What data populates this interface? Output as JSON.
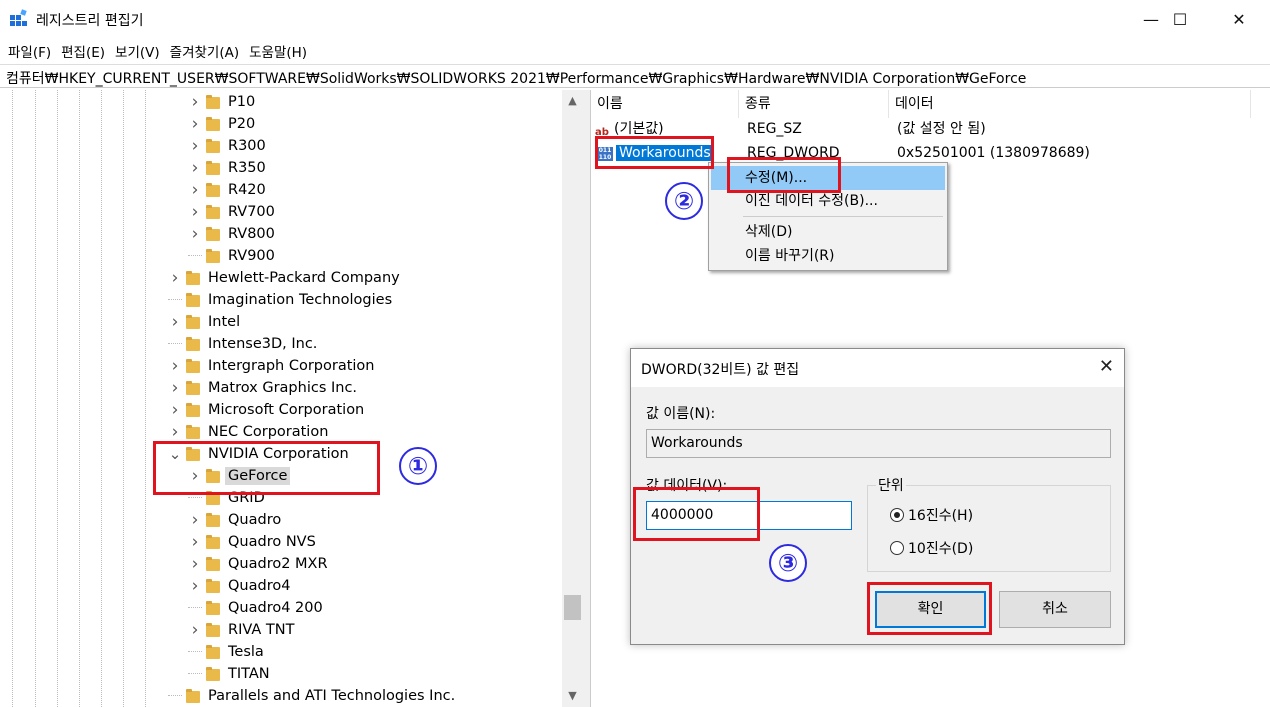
{
  "window": {
    "title": "레지스트리 편집기",
    "minimize_glyph": "—",
    "maximize_glyph": "☐",
    "close_glyph": "✕"
  },
  "menu": [
    "파일(F)",
    "편집(E)",
    "보기(V)",
    "즐겨찾기(A)",
    "도움말(H)"
  ],
  "address": "컴퓨터₩HKEY_CURRENT_USER₩SOFTWARE₩SolidWorks₩SOLIDWORKS 2021₩Performance₩Graphics₩Hardware₩NVIDIA Corporation₩GeForce",
  "tree": {
    "items": [
      {
        "label": "P10",
        "expandable": true
      },
      {
        "label": "P20",
        "expandable": true
      },
      {
        "label": "R300",
        "expandable": true
      },
      {
        "label": "R350",
        "expandable": true
      },
      {
        "label": "R420",
        "expandable": true
      },
      {
        "label": "RV700",
        "expandable": true
      },
      {
        "label": "RV800",
        "expandable": true
      },
      {
        "label": "RV900",
        "expandable": false
      },
      {
        "label": "Hewlett-Packard Company",
        "expandable": true
      },
      {
        "label": "Imagination Technologies",
        "expandable": false
      },
      {
        "label": "Intel",
        "expandable": true
      },
      {
        "label": "Intense3D, Inc.",
        "expandable": false
      },
      {
        "label": "Intergraph Corporation",
        "expandable": true
      },
      {
        "label": "Matrox Graphics Inc.",
        "expandable": true
      },
      {
        "label": "Microsoft Corporation",
        "expandable": true
      },
      {
        "label": "NEC Corporation",
        "expandable": true
      },
      {
        "label": "NVIDIA Corporation",
        "expandable": true,
        "expanded": true
      },
      {
        "label": "GeForce",
        "expandable": true,
        "selected": true
      },
      {
        "label": "GRID",
        "expandable": false
      },
      {
        "label": "Quadro",
        "expandable": true
      },
      {
        "label": "Quadro NVS",
        "expandable": true
      },
      {
        "label": "Quadro2 MXR",
        "expandable": true
      },
      {
        "label": "Quadro4",
        "expandable": true
      },
      {
        "label": "Quadro4 200",
        "expandable": false
      },
      {
        "label": "RIVA TNT",
        "expandable": true
      },
      {
        "label": "Tesla",
        "expandable": false
      },
      {
        "label": "TITAN",
        "expandable": false
      },
      {
        "label": "Parallels and ATI Technologies Inc.",
        "expandable": false
      }
    ]
  },
  "values": {
    "columns": [
      "이름",
      "종류",
      "데이터"
    ],
    "rows": [
      {
        "name": "(기본값)",
        "type": "REG_SZ",
        "data": "(값 설정 안 됨)",
        "icon": "string-value-icon"
      },
      {
        "name": "Workarounds",
        "type": "REG_DWORD",
        "data": "0x52501001 (1380978689)",
        "icon": "binary-value-icon"
      }
    ]
  },
  "context_menu": {
    "items": [
      "수정(M)...",
      "이진 데이터 수정(B)...",
      "삭제(D)",
      "이름 바꾸기(R)"
    ]
  },
  "dialog": {
    "title": "DWORD(32비트) 값 편집",
    "value_name_label": "값 이름(N):",
    "value_name": "Workarounds",
    "value_data_label": "값 데이터(V):",
    "value_data": "4000000",
    "base_label": "단위",
    "base_hex": "16진수(H)",
    "base_dec": "10진수(D)",
    "ok": "확인",
    "cancel": "취소"
  },
  "annotations": {
    "step1": "①",
    "step2": "②",
    "step3": "③"
  },
  "colors": {
    "annotation_box": "#e0141e",
    "annotation_number": "#2d2adf",
    "selection": "#0078d7",
    "menu_highlight": "#91c9f7"
  }
}
